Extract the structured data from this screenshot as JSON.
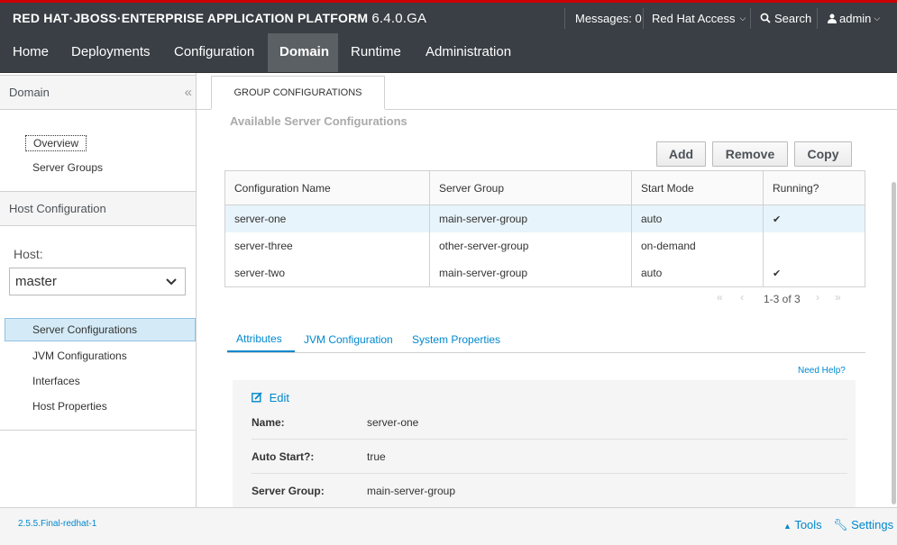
{
  "header": {
    "brand": "RED HAT·JBOSS·ENTERPRISE APPLICATION PLATFORM",
    "version": "6.4.0.GA",
    "messages": "Messages: 0",
    "red_hat_access": "Red Hat Access",
    "search": "Search",
    "user": "admin"
  },
  "nav": {
    "items": [
      "Home",
      "Deployments",
      "Configuration",
      "Domain",
      "Runtime",
      "Administration"
    ],
    "active": "Domain"
  },
  "sidebar": {
    "domain_title": "Domain",
    "domain_links": [
      "Overview",
      "Server Groups"
    ],
    "host_config_title": "Host Configuration",
    "host_label": "Host:",
    "host_value": "master",
    "host_links": [
      "Server Configurations",
      "JVM Configurations",
      "Interfaces",
      "Host Properties"
    ]
  },
  "main": {
    "tab": "GROUP CONFIGURATIONS",
    "section_title": "Available Server Configurations",
    "buttons": {
      "add": "Add",
      "remove": "Remove",
      "copy": "Copy"
    },
    "table": {
      "columns": [
        "Configuration Name",
        "Server Group",
        "Start Mode",
        "Running?"
      ],
      "rows": [
        {
          "name": "server-one",
          "group": "main-server-group",
          "mode": "auto",
          "running": "✔"
        },
        {
          "name": "server-three",
          "group": "other-server-group",
          "mode": "on-demand",
          "running": ""
        },
        {
          "name": "server-two",
          "group": "main-server-group",
          "mode": "auto",
          "running": "✔"
        }
      ]
    },
    "pager": "1-3 of 3",
    "subtabs": [
      "Attributes",
      "JVM Configuration",
      "System Properties"
    ],
    "need_help": "Need Help?",
    "edit": "Edit",
    "attributes": [
      {
        "label": "Name:",
        "value": "server-one"
      },
      {
        "label": "Auto Start?:",
        "value": "true"
      },
      {
        "label": "Server Group:",
        "value": "main-server-group"
      }
    ]
  },
  "footer": {
    "version": "2.5.5.Final-redhat-1",
    "tools": "Tools",
    "settings": "Settings"
  },
  "colors": {
    "accent": "#0088ce",
    "topbar": "#393f44",
    "brand_line": "#cc0000",
    "selected_row": "#e8f4fb"
  }
}
